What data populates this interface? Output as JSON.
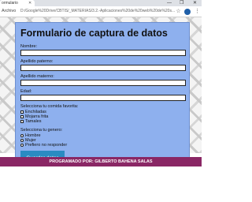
{
  "browser": {
    "tab_title": "ormulario",
    "tab_close": "✕",
    "window_buttons": [
      "—",
      "❐",
      "✕"
    ],
    "address_label": "Archivo",
    "address_url": "D:/Google%20Drive/CBTIS/_MATERIAS/3.2.-Aplicaciones%20de%20web%20de%20s...",
    "icons": [
      "star-icon",
      "profile-icon",
      "menu-icon"
    ]
  },
  "form": {
    "title": "Formulario de captura de datos",
    "fields": {
      "nombre_label": "Nombre:",
      "apellido_paterno_label": "Apellido paterno:",
      "apellido_materno_label": "Apellido materno:",
      "edad_label": "Edad:"
    },
    "food": {
      "label": "Selecciona tu comida favorita:",
      "options": [
        "Enchiladas",
        "Mojarra frita",
        "Tamales"
      ]
    },
    "gender": {
      "label": "Selecciona tu genero:",
      "options": [
        "Hombre",
        "Mujer",
        "Prefiero no responder"
      ]
    },
    "submit_label": "Guardar datos"
  },
  "footer": {
    "text": "PROGRAMADO POR: GILBERTO BAHENA SALAS"
  }
}
